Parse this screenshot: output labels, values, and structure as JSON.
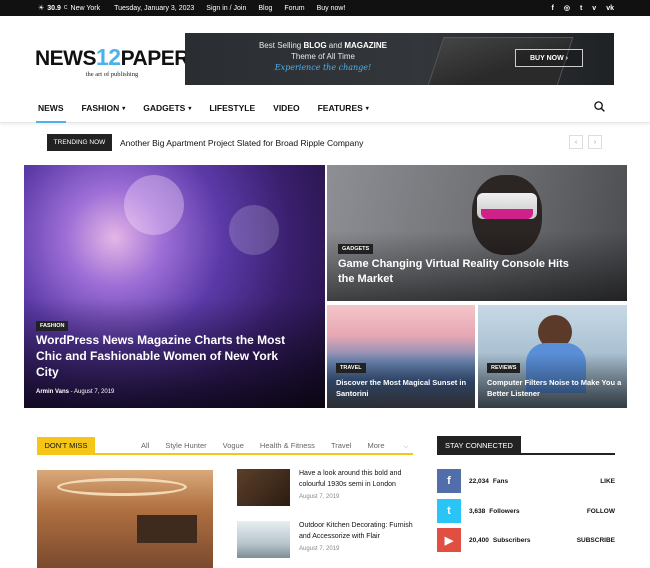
{
  "topbar": {
    "temperature": "30.9",
    "temp_unit": "C",
    "city": "New York",
    "date": "Tuesday, January 3, 2023",
    "links": [
      "Sign in / Join",
      "Blog",
      "Forum",
      "Buy now!"
    ],
    "social_icons": [
      "facebook-icon",
      "instagram-icon",
      "twitter-icon",
      "vimeo-icon",
      "vk-icon"
    ],
    "social_glyphs": [
      "f",
      "◎",
      "t",
      "v",
      "vk"
    ]
  },
  "logo": {
    "part1": "NEWS",
    "part2": "12",
    "part3": "PAPER",
    "tagline": "the art of publishing"
  },
  "banner": {
    "line1_pre": "Best Selling ",
    "line1_bold1": "BLOG",
    "line1_mid": " and ",
    "line1_bold2": "MAGAZINE",
    "line2": "Theme of All Time",
    "line3": "Experience the change!",
    "button": "BUY NOW ›"
  },
  "nav": {
    "items": [
      "NEWS",
      "FASHION",
      "GADGETS",
      "LIFESTYLE",
      "VIDEO",
      "FEATURES"
    ],
    "has_dropdown": [
      false,
      true,
      true,
      false,
      false,
      true
    ]
  },
  "trending": {
    "label": "TRENDING NOW",
    "headline": "Another Big Apartment Project Slated for Broad Ripple Company",
    "prev": "‹",
    "next": "›"
  },
  "featured": [
    {
      "category": "FASHION",
      "title": "WordPress News Magazine Charts the Most Chic and Fashionable Women of New York City",
      "author": "Armin Vans",
      "date": "August 7, 2019"
    },
    {
      "category": "GADGETS",
      "title": "Game Changing Virtual Reality Console Hits the Market"
    },
    {
      "category": "TRAVEL",
      "title": "Discover the Most Magical Sunset in Santorini"
    },
    {
      "category": "REVIEWS",
      "title": "Computer Filters Noise to Make You a Better Listener"
    }
  ],
  "dont_miss": {
    "label": "DON'T MISS",
    "tabs": [
      "All",
      "Style Hunter",
      "Vogue",
      "Health & Fitness",
      "Travel",
      "More"
    ],
    "posts": [
      {
        "title": "Have a look around this bold and colourful 1930s semi in London",
        "date": "August 7, 2019"
      },
      {
        "title": "Outdoor Kitchen Decorating: Furnish and Accessorize with Flair",
        "date": "August 7, 2019"
      }
    ]
  },
  "stay_connected": {
    "label": "STAY CONNECTED",
    "items": [
      {
        "glyph": "f",
        "count": "22,034",
        "name": "Fans",
        "action": "LIKE"
      },
      {
        "glyph": "t",
        "count": "3,638",
        "name": "Followers",
        "action": "FOLLOW"
      },
      {
        "glyph": "▶",
        "count": "20,400",
        "name": "Subscribers",
        "action": "SUBSCRIBE"
      }
    ]
  },
  "colors": {
    "accent": "#4db2ec",
    "dont_miss": "#f5c518",
    "facebook": "#516eab",
    "twitter": "#29c5f6",
    "youtube": "#e14e42"
  }
}
